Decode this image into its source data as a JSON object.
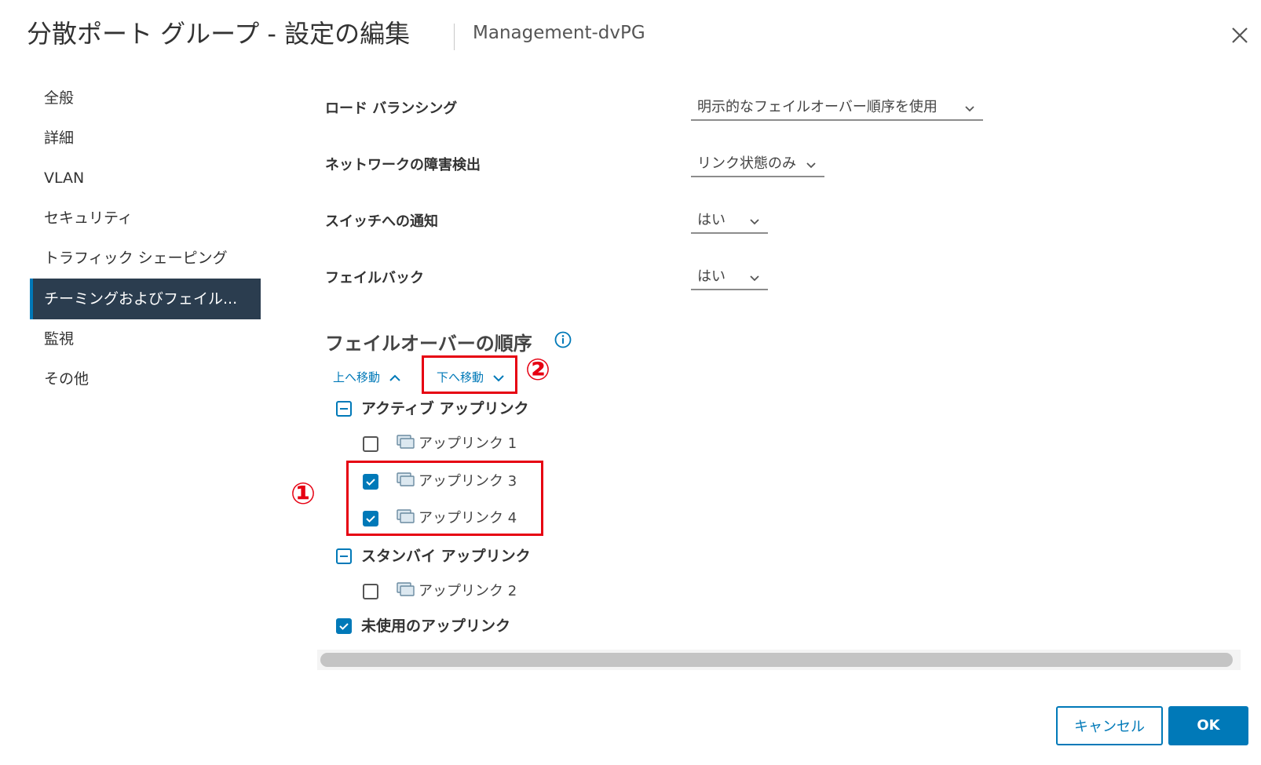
{
  "header": {
    "title": "分散ポート グループ - 設定の編集",
    "subtitle": "Management-dvPG"
  },
  "sidebar": {
    "items": [
      {
        "label": "全般"
      },
      {
        "label": "詳細"
      },
      {
        "label": "VLAN"
      },
      {
        "label": "セキュリティ"
      },
      {
        "label": "トラフィック シェーピング"
      },
      {
        "label": "チーミングおよびフェイル...",
        "active": true
      },
      {
        "label": "監視"
      },
      {
        "label": "その他"
      }
    ]
  },
  "settings": {
    "load_balancing": {
      "label": "ロード バランシング",
      "value": "明示的なフェイルオーバー順序を使用"
    },
    "failure_detection": {
      "label": "ネットワークの障害検出",
      "value": "リンク状態のみ"
    },
    "notify_switches": {
      "label": "スイッチへの通知",
      "value": "はい"
    },
    "failback": {
      "label": "フェイルバック",
      "value": "はい"
    }
  },
  "failover": {
    "title": "フェイルオーバーの順序",
    "move_up": "上へ移動",
    "move_down": "下へ移動",
    "groups": {
      "active": {
        "label": "アクティブ アップリンク",
        "uplinks": [
          {
            "label": "アップリンク 1",
            "checked": false
          },
          {
            "label": "アップリンク 3",
            "checked": true
          },
          {
            "label": "アップリンク 4",
            "checked": true
          }
        ]
      },
      "standby": {
        "label": "スタンバイ アップリンク",
        "uplinks": [
          {
            "label": "アップリンク 2",
            "checked": false
          }
        ]
      },
      "unused": {
        "label": "未使用のアップリンク",
        "checked": true
      }
    }
  },
  "annotations": {
    "one": "①",
    "two": "②"
  },
  "footer": {
    "cancel_label": "キャンセル",
    "ok_label": "OK"
  },
  "colors": {
    "accent": "#0079b8",
    "sidebar_active_bg": "#2b3d4f",
    "annotation_red": "#e60012"
  }
}
